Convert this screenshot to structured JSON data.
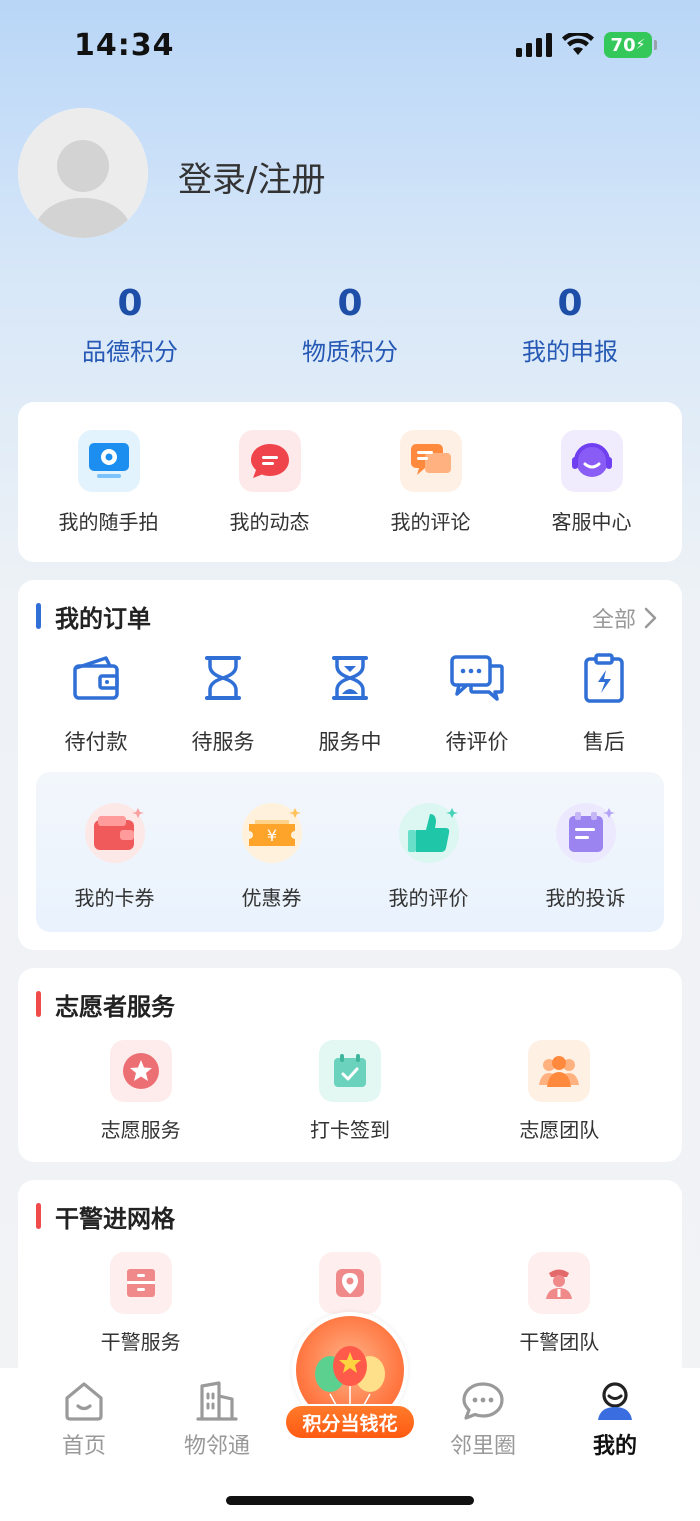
{
  "status_bar": {
    "time": "14:34",
    "battery": "70"
  },
  "profile": {
    "login_label": "登录/注册"
  },
  "stats": [
    {
      "value": "0",
      "label": "品德积分"
    },
    {
      "value": "0",
      "label": "物质积分"
    },
    {
      "value": "0",
      "label": "我的申报"
    }
  ],
  "quick_actions": [
    {
      "label": "我的随手拍",
      "icon": "camera-icon"
    },
    {
      "label": "我的动态",
      "icon": "message-icon"
    },
    {
      "label": "我的评论",
      "icon": "comment-icon"
    },
    {
      "label": "客服中心",
      "icon": "headset-icon"
    }
  ],
  "orders": {
    "title": "我的订单",
    "more_label": "全部",
    "items": [
      {
        "label": "待付款",
        "icon": "wallet-icon"
      },
      {
        "label": "待服务",
        "icon": "hourglass-icon"
      },
      {
        "label": "服务中",
        "icon": "hourglass-running-icon"
      },
      {
        "label": "待评价",
        "icon": "chat-icon"
      },
      {
        "label": "售后",
        "icon": "clipboard-icon"
      }
    ],
    "sub_items": [
      {
        "label": "我的卡券",
        "icon": "card-wallet-icon"
      },
      {
        "label": "优惠券",
        "icon": "coupon-icon"
      },
      {
        "label": "我的评价",
        "icon": "thumbs-up-icon"
      },
      {
        "label": "我的投诉",
        "icon": "complaint-icon"
      }
    ]
  },
  "volunteer": {
    "title": "志愿者服务",
    "items": [
      {
        "label": "志愿服务",
        "icon": "star-icon"
      },
      {
        "label": "打卡签到",
        "icon": "calendar-check-icon"
      },
      {
        "label": "志愿团队",
        "icon": "team-icon"
      }
    ]
  },
  "police": {
    "title": "干警进网格",
    "items": [
      {
        "label": "干警服务",
        "icon": "cabinet-icon"
      },
      {
        "label": "",
        "icon": "location-icon"
      },
      {
        "label": "干警团队",
        "icon": "officer-icon"
      }
    ]
  },
  "promo": {
    "label": "积分当钱花"
  },
  "bottom_nav": [
    {
      "label": "首页",
      "icon": "home-icon"
    },
    {
      "label": "物邻通",
      "icon": "building-icon"
    },
    {
      "label": "邻里圈",
      "icon": "chat-bubble-icon"
    },
    {
      "label": "我的",
      "icon": "user-icon",
      "active": true
    }
  ],
  "colors": {
    "accent_blue": "#2f6fd6",
    "section_red": "#f04a4a",
    "promo_orange": "#ff6a1f"
  }
}
